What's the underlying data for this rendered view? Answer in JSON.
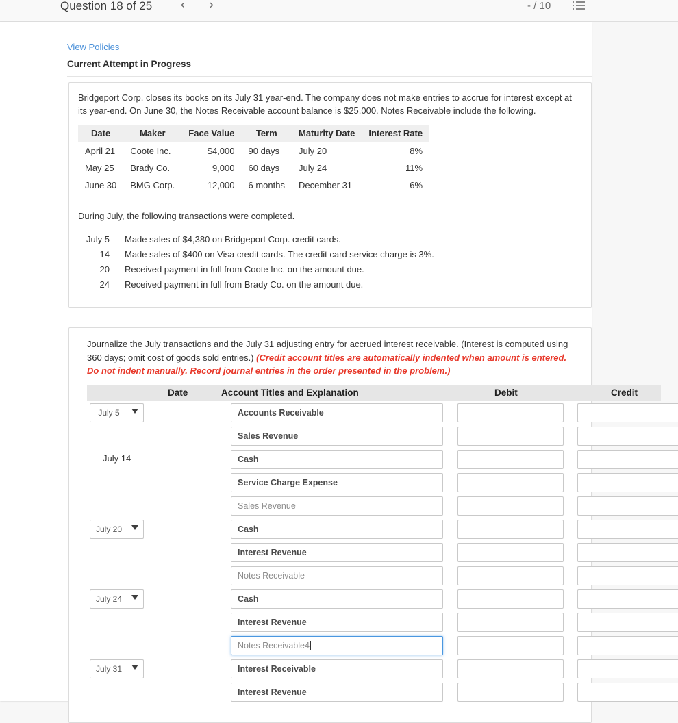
{
  "header": {
    "question_label": "Question 18 of 25",
    "prev_icon": "chevron-left-icon",
    "next_icon": "chevron-right-icon",
    "score": "- / 10",
    "list_icon": "list-view-icon"
  },
  "panel": {
    "view_policies": "View Policies",
    "attempt_status": "Current Attempt in Progress"
  },
  "problem": {
    "intro": "Bridgeport Corp. closes its books on its July 31 year-end. The company does not make entries to accrue for interest except at its year-end. On June 30, the Notes Receivable account balance is $25,000. Notes Receivable include the following.",
    "notes_table": {
      "columns": [
        "Date",
        "Maker",
        "Face Value",
        "Term",
        "Maturity Date",
        "Interest Rate"
      ],
      "rows": [
        [
          "April 21",
          "Coote Inc.",
          "$4,000",
          "90 days",
          "July 20",
          "8%"
        ],
        [
          "May 25",
          "Brady Co.",
          "9,000",
          "60 days",
          "July 24",
          "11%"
        ],
        [
          "June 30",
          "BMG Corp.",
          "12,000",
          "6 months",
          "December 31",
          "6%"
        ]
      ]
    },
    "during_july": "During July, the following transactions were completed.",
    "transactions": [
      {
        "date": "July 5",
        "text": "Made sales of $4,380 on Bridgeport Corp. credit cards."
      },
      {
        "date": "14",
        "text": "Made sales of $400 on Visa credit cards. The credit card service charge is 3%."
      },
      {
        "date": "20",
        "text": "Received payment in full from Coote Inc. on the amount due."
      },
      {
        "date": "24",
        "text": "Received payment in full from Brady Co. on the amount due."
      }
    ]
  },
  "journal": {
    "instruction_plain": "Journalize the July transactions and the July 31 adjusting entry for accrued interest receivable. (Interest is computed using 360 days; omit cost of goods sold entries.) ",
    "instruction_red": "(Credit account titles are automatically indented when amount is entered. Do not indent manually. Record journal entries in the order presented in the problem.)",
    "columns": {
      "date": "Date",
      "account": "Account Titles and Explanation",
      "debit": "Debit",
      "credit": "Credit"
    },
    "date_options": [
      "July 5",
      "July 14",
      "July 20",
      "July 24",
      "July 31"
    ],
    "rows": [
      {
        "date_value": "July 5",
        "date_type": "select",
        "account": "Accounts Receivable",
        "account_style": "filled",
        "focused": false,
        "debit": "",
        "credit": ""
      },
      {
        "date_value": "",
        "date_type": "none",
        "account": "Sales Revenue",
        "account_style": "filled",
        "focused": false,
        "debit": "",
        "credit": ""
      },
      {
        "date_value": "July 14",
        "date_type": "static",
        "account": "Cash",
        "account_style": "filled",
        "focused": false,
        "debit": "",
        "credit": ""
      },
      {
        "date_value": "",
        "date_type": "none",
        "account": "Service Charge Expense",
        "account_style": "filled",
        "focused": false,
        "debit": "",
        "credit": ""
      },
      {
        "date_value": "",
        "date_type": "none",
        "account": "Sales Revenue",
        "account_style": "ghost",
        "focused": false,
        "debit": "",
        "credit": ""
      },
      {
        "date_value": "July 20",
        "date_type": "select",
        "account": "Cash",
        "account_style": "filled",
        "focused": false,
        "debit": "",
        "credit": ""
      },
      {
        "date_value": "",
        "date_type": "none",
        "account": "Interest Revenue",
        "account_style": "filled",
        "focused": false,
        "debit": "",
        "credit": ""
      },
      {
        "date_value": "",
        "date_type": "none",
        "account": "Notes Receivable",
        "account_style": "ghost",
        "focused": false,
        "debit": "",
        "credit": ""
      },
      {
        "date_value": "July 24",
        "date_type": "select",
        "account": "Cash",
        "account_style": "filled",
        "focused": false,
        "debit": "",
        "credit": ""
      },
      {
        "date_value": "",
        "date_type": "none",
        "account": "Interest Revenue",
        "account_style": "filled",
        "focused": false,
        "debit": "",
        "credit": ""
      },
      {
        "date_value": "",
        "date_type": "none",
        "account": "Notes Receivable4",
        "account_style": "ghost",
        "focused": true,
        "debit": "",
        "credit": ""
      },
      {
        "date_value": "July 31",
        "date_type": "select",
        "account": "Interest Receivable",
        "account_style": "filled",
        "focused": false,
        "debit": "",
        "credit": ""
      },
      {
        "date_value": "",
        "date_type": "none",
        "account": "Interest Revenue",
        "account_style": "filled",
        "focused": false,
        "debit": "",
        "credit": ""
      }
    ]
  },
  "colors": {
    "link": "#4a90d9",
    "alert_red": "#e8392b",
    "focus_blue": "#4a97e0",
    "page_bg": "#f7f7f7"
  }
}
